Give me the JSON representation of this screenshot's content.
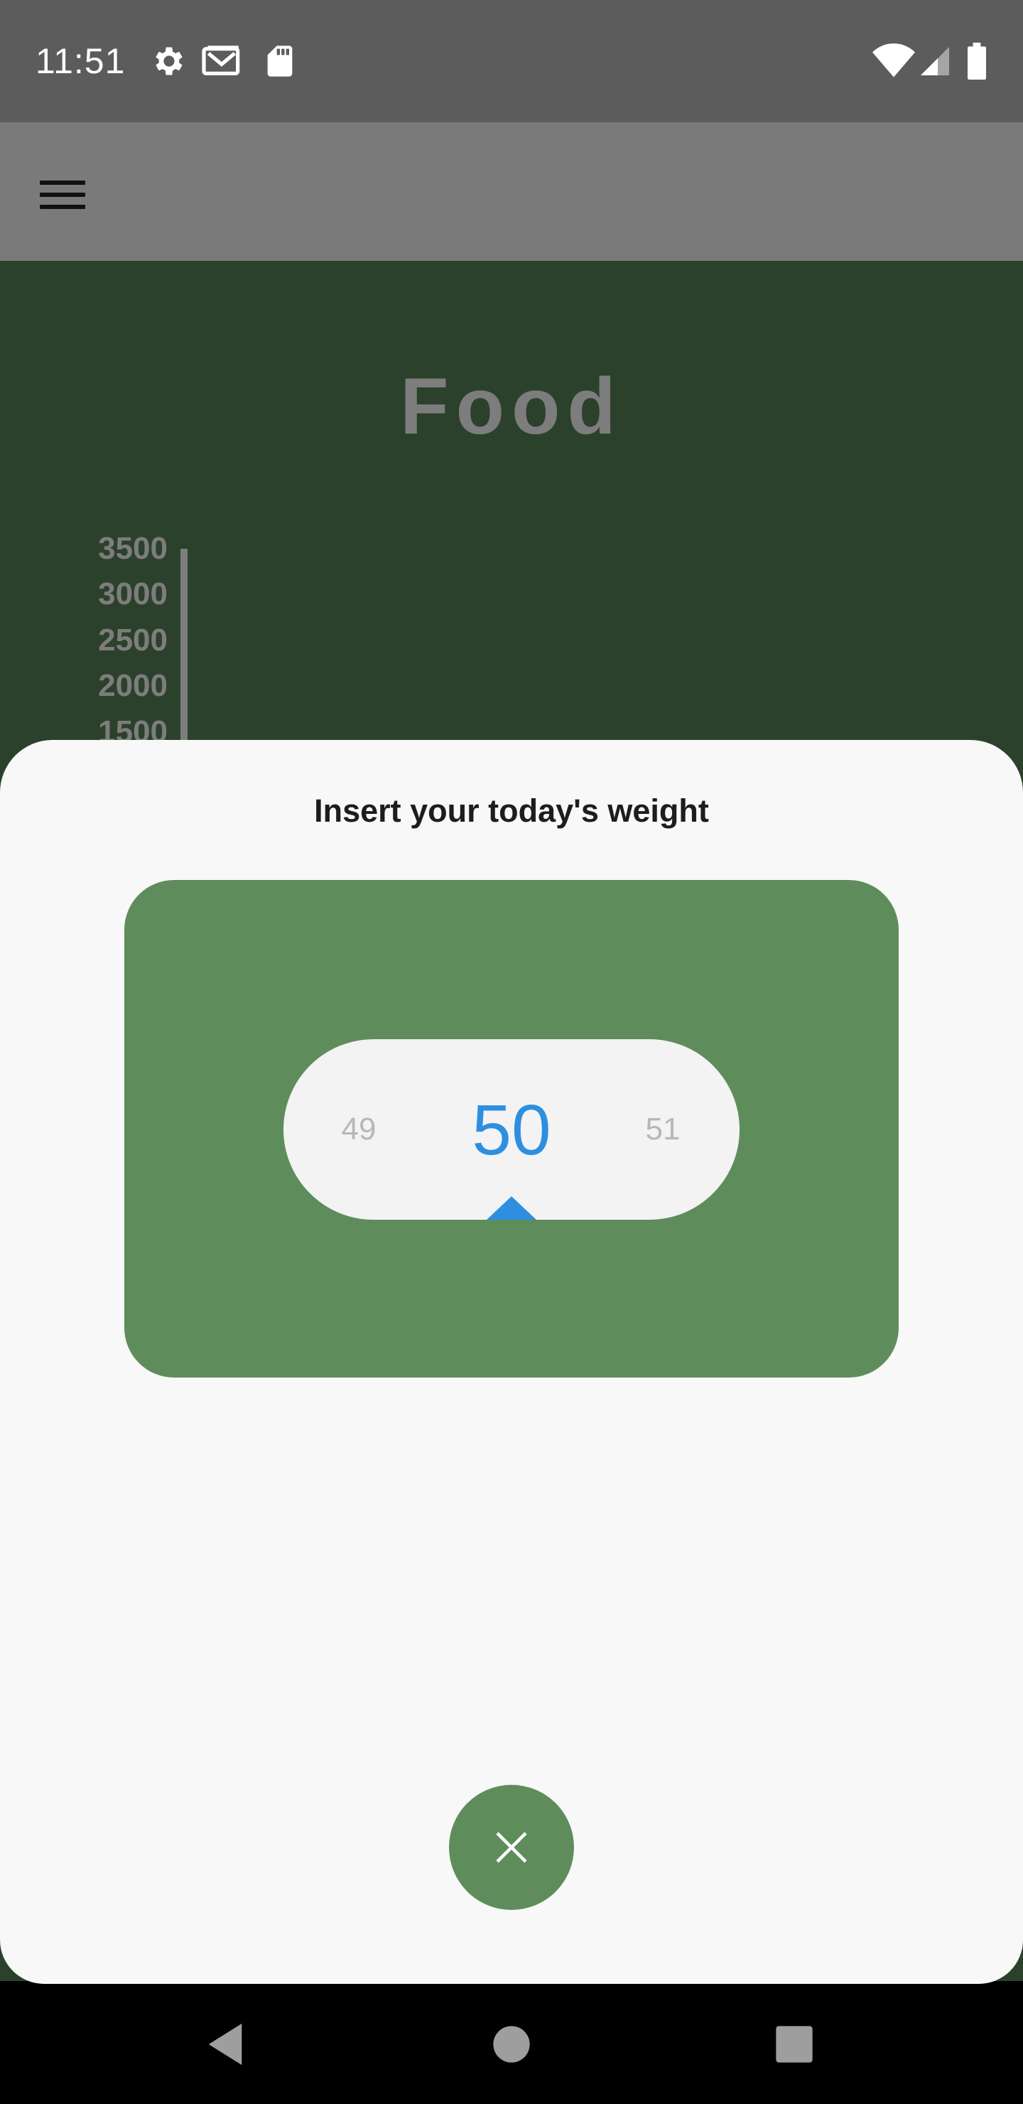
{
  "status_bar": {
    "time": "11:51",
    "left_icons": [
      "settings-icon",
      "gmail-icon",
      "sd-card-icon"
    ],
    "right_icons": [
      "wifi-icon",
      "cell-signal-icon",
      "battery-icon"
    ]
  },
  "app_bar": {
    "menu_icon": "hamburger-menu-icon"
  },
  "chart": {
    "title": "Food",
    "y_ticks": [
      "3500",
      "3000",
      "2500",
      "2000",
      "1500"
    ]
  },
  "sheet": {
    "title": "Insert your today's weight",
    "picker": {
      "previous": "49",
      "current": "50",
      "next": "51"
    },
    "close_icon": "close-icon"
  },
  "nav_bar": {
    "back_icon": "back-icon",
    "home_icon": "home-icon",
    "recents_icon": "recents-icon"
  },
  "colors": {
    "status_bar": "#5c5c5c",
    "app_bar": "#7a7a7a",
    "content_background": "#2c412b",
    "sheet_background": "#f8f8f8",
    "accent_green": "#5e8d5b",
    "picker_blue": "#2e8fe0"
  }
}
